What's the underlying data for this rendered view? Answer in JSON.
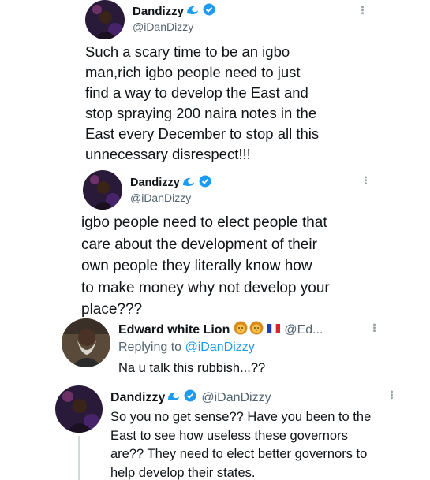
{
  "tweets": [
    {
      "name": "Dandizzy",
      "handle": "@iDanDizzy",
      "lines": [
        "Such a scary time to be an igbo",
        "man,rich igbo people need to just",
        "find a way to develop the East and",
        "stop spraying 200 naira notes in the",
        "East every December to stop all this",
        "unnecessary disrespect!!!"
      ]
    },
    {
      "name": "Dandizzy",
      "handle": "@iDanDizzy",
      "lines": [
        "igbo people need to elect people that",
        "care about the development of their",
        "own people they literally know how",
        "to make money why not develop your",
        "place???"
      ]
    }
  ],
  "reply": {
    "name": "Edward white Lion",
    "handle": "@Ed...",
    "replying_prefix": "Replying to ",
    "replying_handle": "@iDanDizzy",
    "text": "Na u talk this rubbish...??"
  },
  "answer": {
    "name": "Dandizzy",
    "handle": "@iDanDizzy",
    "lines": [
      "So you no get sense?? Have you been to the",
      "East to see how useless these governors",
      "are?? They need to elect better governors to",
      "help develop their states."
    ]
  },
  "icons": {
    "wave": "wave-icon",
    "verified": "verified-badge-icon",
    "more": "more-options-icon",
    "lion": "lion-face-icon",
    "flag": "france-flag-icon"
  },
  "colors": {
    "verified": "#1d9bf0",
    "mention": "#1d9bf0",
    "muted": "#536471"
  }
}
